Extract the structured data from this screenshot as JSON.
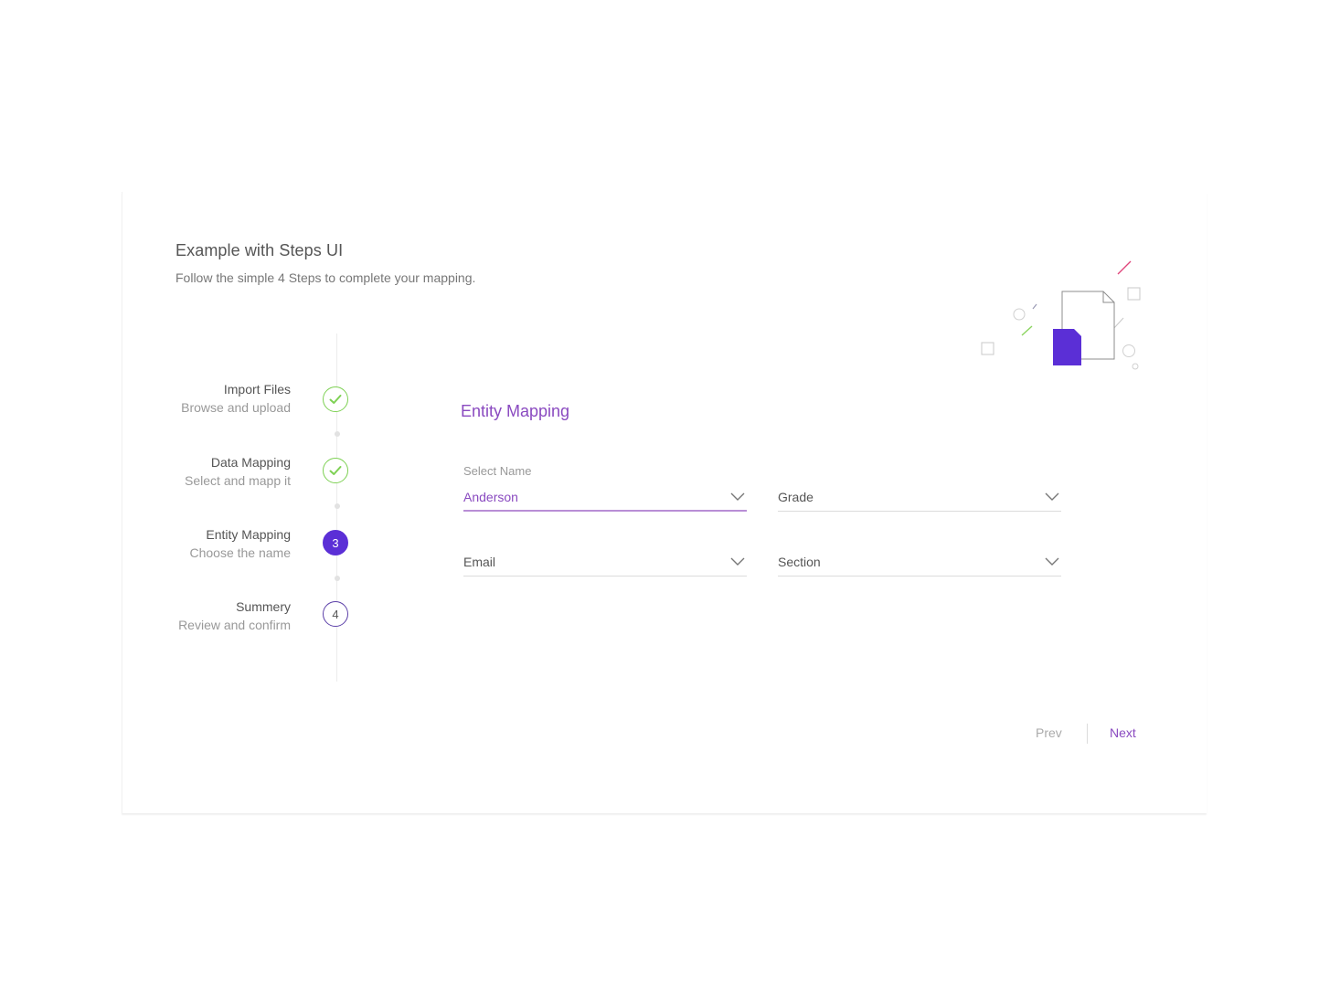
{
  "header": {
    "title": "Example with Steps UI",
    "subtitle": "Follow the simple 4 Steps to complete your mapping."
  },
  "steps": [
    {
      "title": "Import Files",
      "description": "Browse and upload",
      "status": "completed",
      "marker": "check-icon"
    },
    {
      "title": "Data Mapping",
      "description": "Select and mapp it",
      "status": "completed",
      "marker": "check-icon"
    },
    {
      "title": "Entity Mapping",
      "description": "Choose the name",
      "status": "active",
      "marker": "3"
    },
    {
      "title": "Summery",
      "description": "Review and confirm",
      "status": "upcoming",
      "marker": "4"
    }
  ],
  "form": {
    "title": "Entity Mapping",
    "fields": [
      {
        "label": "Select Name",
        "value": "Anderson",
        "active": true
      },
      {
        "label": "",
        "value": "Grade",
        "active": false
      },
      {
        "label": "",
        "value": "Email",
        "active": false
      },
      {
        "label": "",
        "value": "Section",
        "active": false
      }
    ]
  },
  "navigation": {
    "prev_label": "Prev",
    "next_label": "Next"
  },
  "colors": {
    "accent_purple": "#8a4ac0",
    "active_step": "#5b2fd6",
    "completed_green": "#7ed154"
  }
}
